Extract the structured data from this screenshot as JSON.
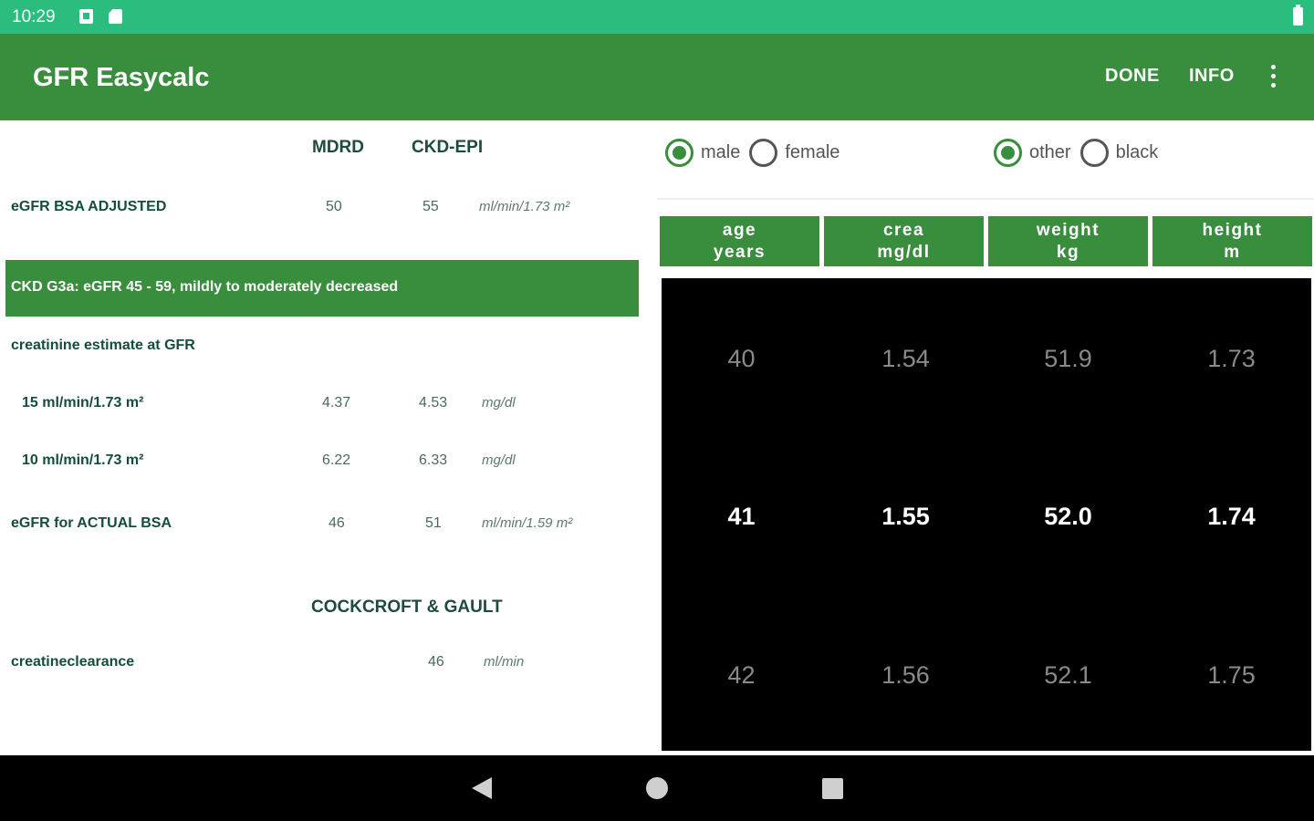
{
  "status_bar": {
    "time": "10:29",
    "icons": [
      "image-icon",
      "sd-card-icon",
      "battery-icon"
    ]
  },
  "app_bar": {
    "title": "GFR Easycalc",
    "actions": {
      "done": "DONE",
      "info": "INFO"
    },
    "more_icon": "more-vert-icon"
  },
  "results": {
    "col_mdrd": "MDRD",
    "col_ckdepi": "CKD-EPI",
    "egfr_bsa": {
      "label": "eGFR BSA ADJUSTED",
      "mdrd": "50",
      "ckdepi": "55",
      "unit": "ml/min/1.73 m²"
    },
    "ckd_stage": "CKD G3a: eGFR 45 - 59, mildly to moderately decreased",
    "crea_estimate_label": "creatinine estimate at GFR",
    "crea_15": {
      "label": "15 ml/min/1.73 m²",
      "mdrd": "4.37",
      "ckdepi": "4.53",
      "unit": "mg/dl"
    },
    "crea_10": {
      "label": "10 ml/min/1.73 m²",
      "mdrd": "6.22",
      "ckdepi": "6.33",
      "unit": "mg/dl"
    },
    "egfr_actual": {
      "label": "eGFR for ACTUAL BSA",
      "mdrd": "46",
      "ckdepi": "51",
      "unit": "ml/min/1.59 m²"
    },
    "cockcroft_title": "COCKCROFT & GAULT",
    "clearance": {
      "label": "creatineclearance",
      "value": "46",
      "unit": "ml/min"
    }
  },
  "inputs": {
    "sex": {
      "options": [
        "male",
        "female"
      ],
      "selected": "male"
    },
    "ethnicity": {
      "options": [
        "other",
        "black"
      ],
      "selected": "other"
    },
    "columns": [
      {
        "line1": "age",
        "line2": "years",
        "values": [
          "40",
          "41",
          "42"
        ]
      },
      {
        "line1": "crea",
        "line2": "mg/dl",
        "values": [
          "1.54",
          "1.55",
          "1.56"
        ]
      },
      {
        "line1": "weight",
        "line2": "kg",
        "values": [
          "51.9",
          "52.0",
          "52.1"
        ]
      },
      {
        "line1": "height",
        "line2": "m",
        "values": [
          "1.73",
          "1.74",
          "1.75"
        ]
      }
    ]
  },
  "nav_bar": {
    "icons": [
      "back-icon",
      "home-icon",
      "recents-icon"
    ]
  }
}
